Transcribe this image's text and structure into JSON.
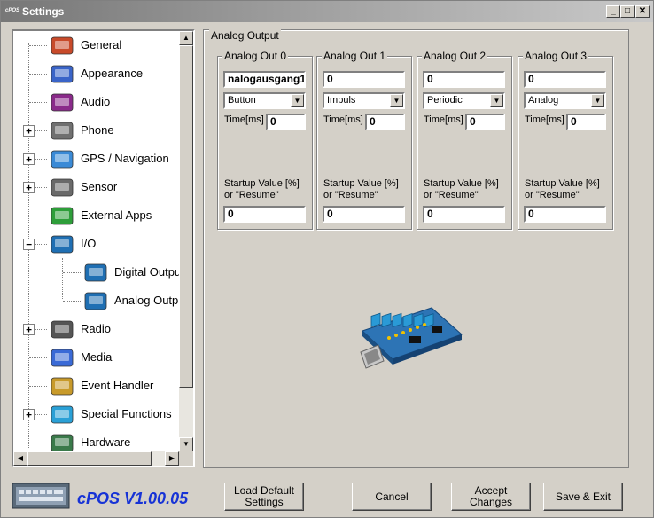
{
  "window": {
    "title": "Settings",
    "logo_text": "cPOS",
    "minimize": "_",
    "maximize": "□",
    "close": "✕"
  },
  "sidebar": {
    "items": [
      {
        "label": "General",
        "icon": "house-icon",
        "expander": ""
      },
      {
        "label": "Appearance",
        "icon": "monitor-icon",
        "expander": ""
      },
      {
        "label": "Audio",
        "icon": "audio-icon",
        "expander": ""
      },
      {
        "label": "Phone",
        "icon": "phone-icon",
        "expander": "+"
      },
      {
        "label": "GPS / Navigation",
        "icon": "satellite-icon",
        "expander": "+"
      },
      {
        "label": "Sensor",
        "icon": "chip-icon",
        "expander": "+"
      },
      {
        "label": "External Apps",
        "icon": "windows-icon",
        "expander": ""
      },
      {
        "label": "I/O",
        "icon": "io-board-icon",
        "expander": "−"
      },
      {
        "label": "Digital Outpu",
        "icon": "io-board-icon",
        "expander": ""
      },
      {
        "label": "Analog Outpu",
        "icon": "io-board-icon",
        "expander": ""
      },
      {
        "label": "Radio",
        "icon": "radio-icon",
        "expander": "+"
      },
      {
        "label": "Media",
        "icon": "media-icon",
        "expander": ""
      },
      {
        "label": "Event Handler",
        "icon": "event-icon",
        "expander": ""
      },
      {
        "label": "Special Functions",
        "icon": "special-icon",
        "expander": "+"
      },
      {
        "label": "Hardware",
        "icon": "hardware-icon",
        "expander": ""
      }
    ]
  },
  "panel": {
    "title": "Analog Output",
    "time_label": "Time[ms]",
    "startup_label_1": "Startup Value [%]",
    "startup_label_2": "or \"Resume\"",
    "outputs": [
      {
        "title": "Analog Out 0",
        "name": "nalogausgang1",
        "mode": "Button",
        "time": "0",
        "startup": "0"
      },
      {
        "title": "Analog Out 1",
        "name": "0",
        "mode": "Impuls",
        "time": "0",
        "startup": "0"
      },
      {
        "title": "Analog Out 2",
        "name": "0",
        "mode": "Periodic",
        "time": "0",
        "startup": "0"
      },
      {
        "title": "Analog Out 3",
        "name": "0",
        "mode": "Analog",
        "time": "0",
        "startup": "0"
      }
    ]
  },
  "footer": {
    "brand": "cPOS V1.00.05",
    "load_default_1": "Load Default",
    "load_default_2": "Settings",
    "cancel": "Cancel",
    "accept": "Accept Changes",
    "save_exit": "Save & Exit"
  },
  "colors": {
    "brand": "#1733d6",
    "window_bg": "#d4d0c8",
    "titlebar": "#8a8a8a"
  }
}
